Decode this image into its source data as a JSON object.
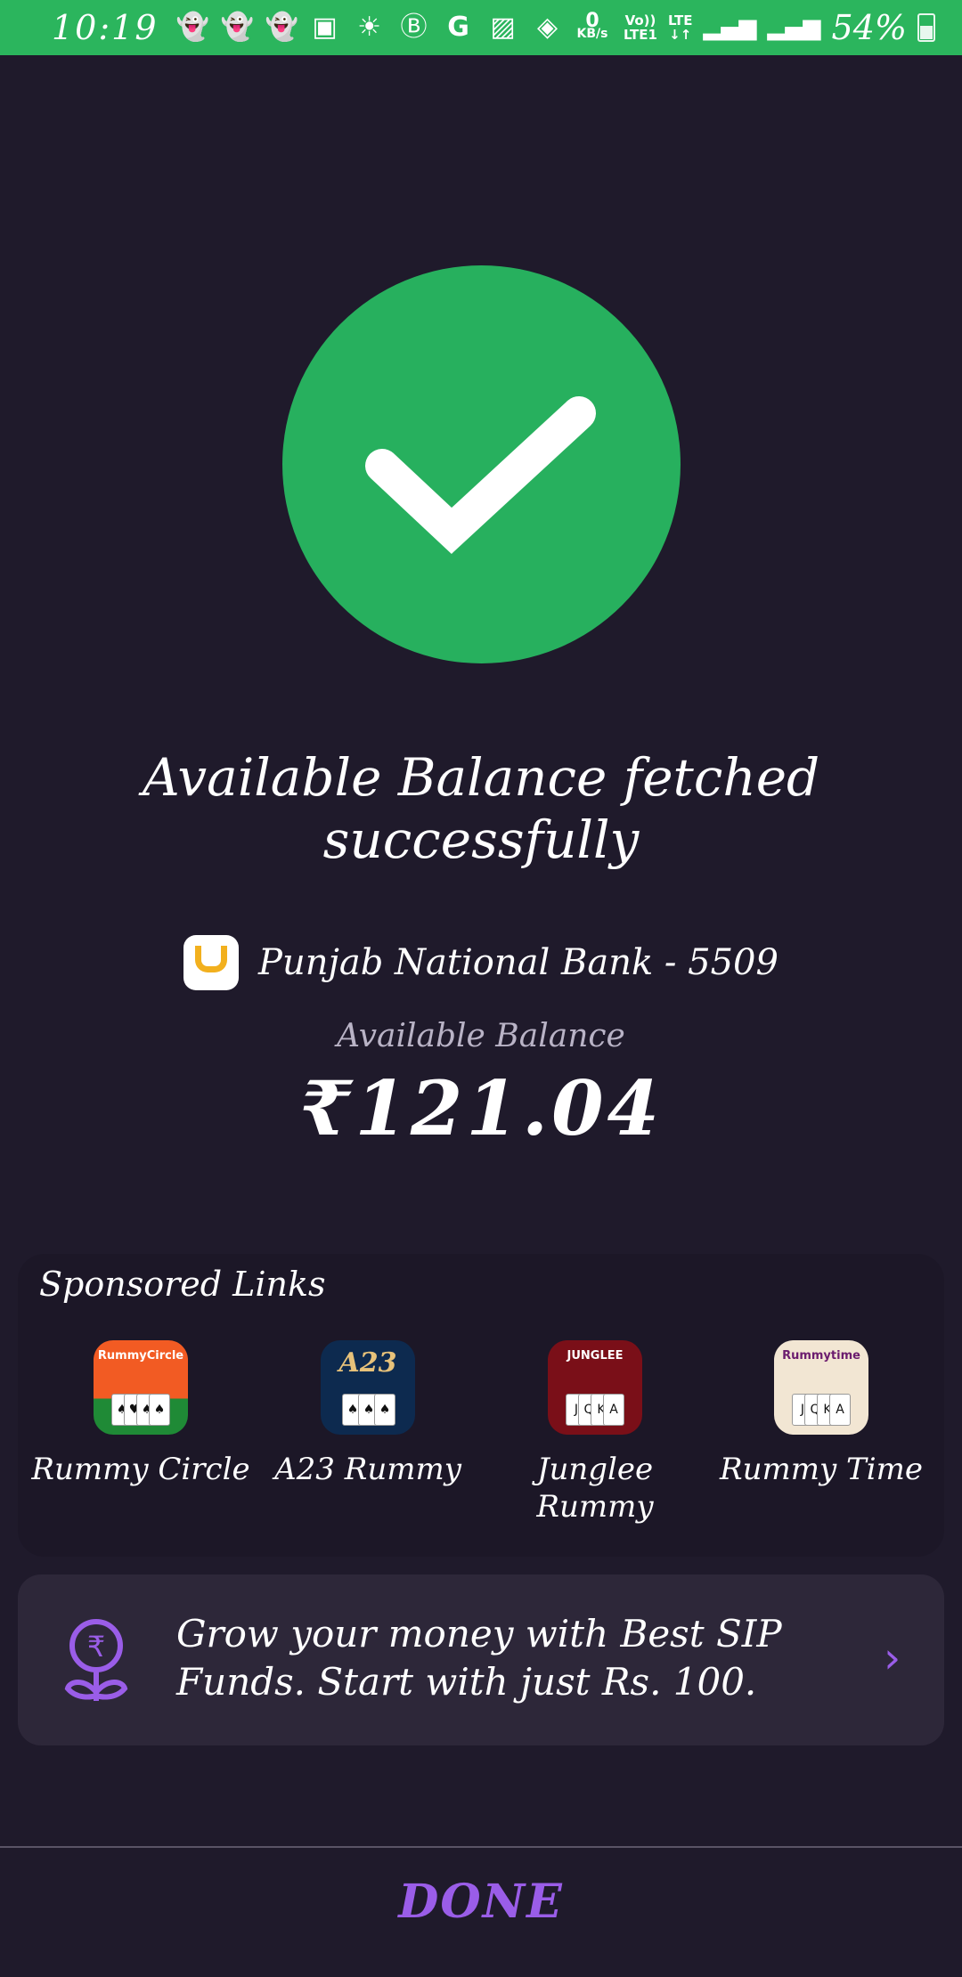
{
  "status_bar": {
    "time": "10:19",
    "net_speed_value": "0",
    "net_speed_unit": "KB/s",
    "volte_label": "Vo))",
    "lte1_label": "LTE1",
    "lte_label": "LTE",
    "battery": "54%",
    "icons": [
      "snapchat-icon",
      "snapchat-icon",
      "snapchat-icon",
      "voicemail-icon",
      "weather-icon",
      "b-icon",
      "google-icon",
      "gallery-icon",
      "wifi-icon"
    ]
  },
  "main": {
    "title": "Available Balance fetched successfully",
    "bank_name": "Punjab National Bank - 5509",
    "balance_label": "Available Balance",
    "balance_value": "₹121.04"
  },
  "sponsored": {
    "title": "Sponsored Links",
    "apps": [
      {
        "name": "Rummy Circle",
        "icon_text": "RummyCircle"
      },
      {
        "name": "A23 Rummy",
        "icon_text": "A23"
      },
      {
        "name": "Junglee Rummy",
        "icon_text": "JUNGLEE"
      },
      {
        "name": "Rummy Time",
        "icon_text": "Rummytime"
      }
    ]
  },
  "sip_banner": {
    "text": "Grow your money with Best SIP Funds. Start with just Rs. 100."
  },
  "footer": {
    "done_label": "DONE"
  },
  "colors": {
    "background": "#1f1a2b",
    "status_green": "#2bb55d",
    "success_green": "#27b05e",
    "accent_purple": "#9a5de8",
    "banner_bg": "#2d2739"
  }
}
